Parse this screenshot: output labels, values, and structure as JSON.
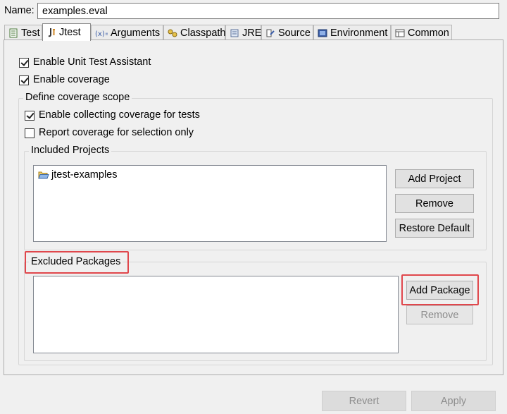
{
  "name": {
    "label": "Name:",
    "value": "examples.eval"
  },
  "tabs": [
    {
      "label": "Test",
      "icon": "test-icon"
    },
    {
      "label": "Jtest",
      "icon": "jtest-icon",
      "active": true
    },
    {
      "label": "Arguments",
      "icon": "arguments-icon"
    },
    {
      "label": "Classpath",
      "icon": "classpath-icon"
    },
    {
      "label": "JRE",
      "icon": "jre-icon"
    },
    {
      "label": "Source",
      "icon": "source-icon"
    },
    {
      "label": "Environment",
      "icon": "environment-icon"
    },
    {
      "label": "Common",
      "icon": "common-icon"
    }
  ],
  "options": {
    "unit_test_assistant": {
      "label": "Enable Unit Test Assistant",
      "checked": true
    },
    "enable_coverage": {
      "label": "Enable coverage",
      "checked": true
    }
  },
  "coverage_scope": {
    "title": "Define coverage scope",
    "collect_for_tests": {
      "label": "Enable collecting coverage for tests",
      "checked": true
    },
    "selection_only": {
      "label": "Report coverage for selection only",
      "checked": false
    }
  },
  "included_projects": {
    "title": "Included Projects",
    "items": [
      "jtest-examples"
    ],
    "add_button": "Add Project",
    "remove_button": "Remove",
    "restore_button": "Restore Default"
  },
  "excluded_packages": {
    "title": "Excluded Packages",
    "items": [],
    "add_button": "Add Package",
    "remove_button": "Remove"
  },
  "footer": {
    "revert_button": "Revert",
    "apply_button": "Apply"
  },
  "colors": {
    "highlight": "#e0474c",
    "folder": "#e6b04a"
  }
}
